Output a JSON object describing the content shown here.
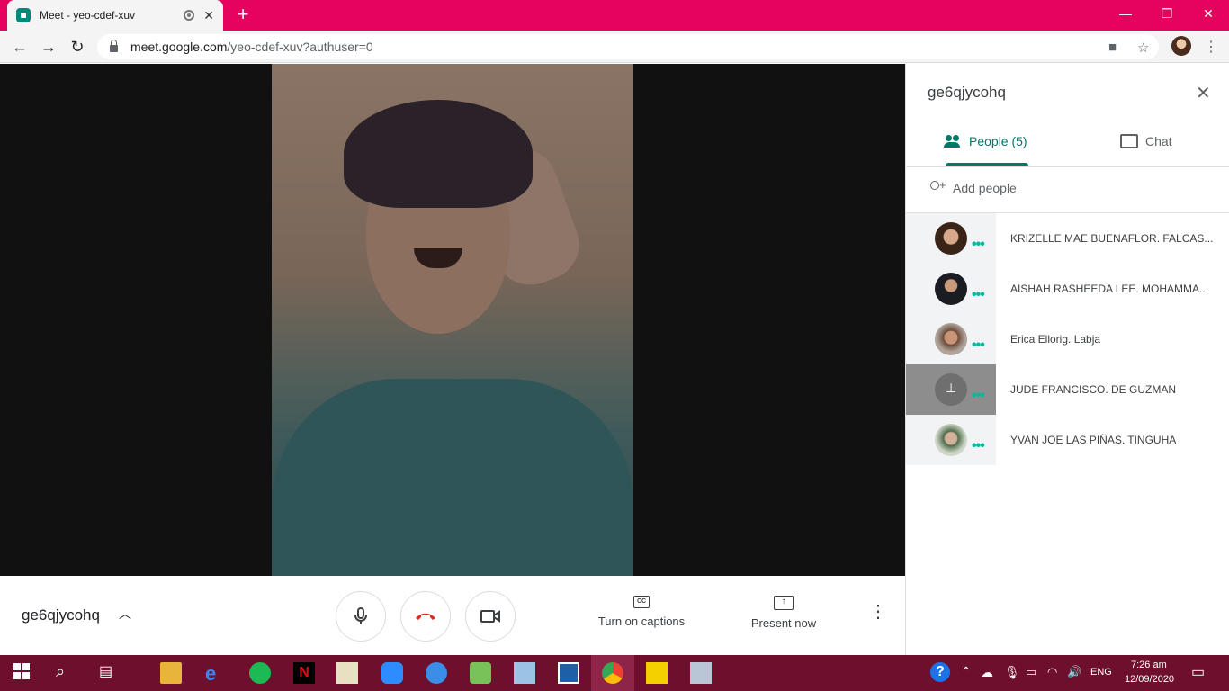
{
  "browser": {
    "tab_title": "Meet - yeo-cdef-xuv",
    "url_host": "meet.google.com",
    "url_path": "/yeo-cdef-xuv?authuser=0",
    "accent": "#e5035f"
  },
  "meet": {
    "meeting_code": "ge6qjycohq",
    "captions_label": "Turn on captions",
    "present_label": "Present now"
  },
  "panel": {
    "title": "ge6qjycohq",
    "people_tab": "People (5)",
    "chat_tab": "Chat",
    "add_people": "Add people",
    "people": [
      {
        "name": "KRIZELLE MAE BUENAFLOR. FALCAS..."
      },
      {
        "name": "AISHAH RASHEEDA LEE. MOHAMMA..."
      },
      {
        "name": "Erica Ellorig. Labja"
      },
      {
        "name": "JUDE FRANCISCO. DE GUZMAN"
      },
      {
        "name": "YVAN JOE LAS PIÑAS. TINGUHA"
      }
    ]
  },
  "taskbar": {
    "language": "ENG",
    "time": "7:26 am",
    "date": "12/09/2020"
  }
}
